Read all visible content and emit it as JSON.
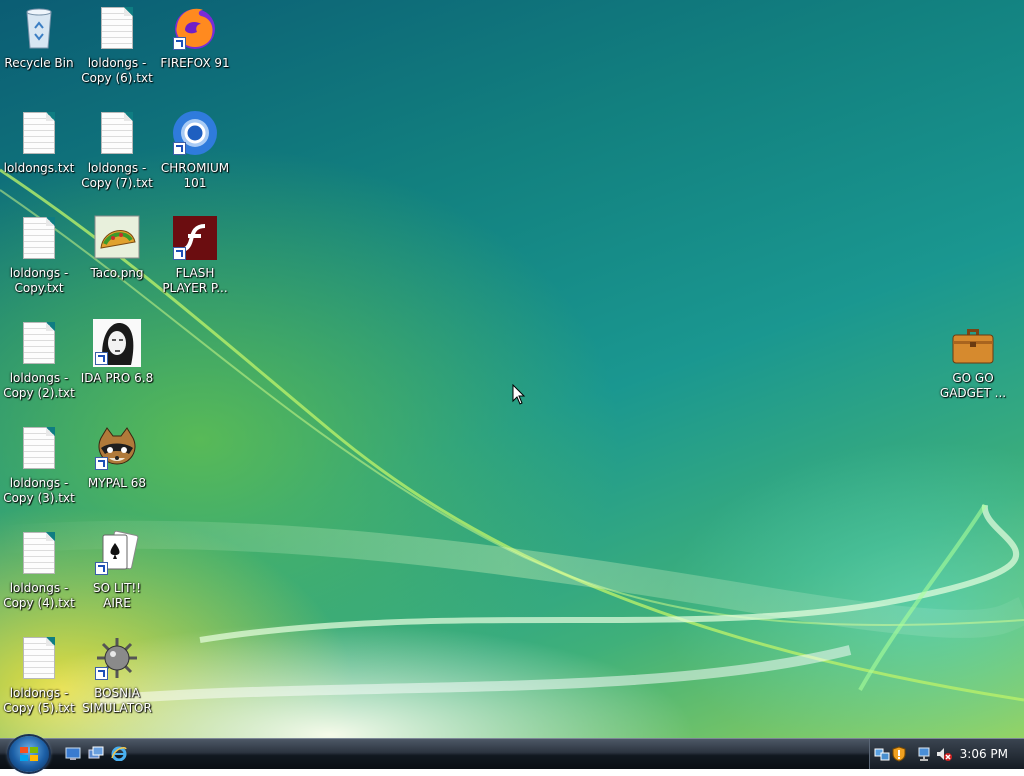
{
  "desktop": {
    "icons": [
      {
        "label": "Recycle Bin",
        "icon": "recycle-bin-icon"
      },
      {
        "label": "loldongs - Copy (6).txt",
        "icon": "text-file-icon"
      },
      {
        "label": "FIREFOX 91",
        "icon": "firefox-icon"
      },
      {
        "label": "loldongs.txt",
        "icon": "text-file-icon"
      },
      {
        "label": "loldongs - Copy (7).txt",
        "icon": "text-file-icon"
      },
      {
        "label": "CHROMIUM 101",
        "icon": "chromium-icon"
      },
      {
        "label": "loldongs - Copy.txt",
        "icon": "text-file-icon"
      },
      {
        "label": "Taco.png",
        "icon": "taco-image-icon"
      },
      {
        "label": "FLASH PLAYER P...",
        "icon": "flash-player-icon"
      },
      {
        "label": "loldongs - Copy (2).txt",
        "icon": "text-file-icon"
      },
      {
        "label": "IDA PRO 6.8",
        "icon": "ida-pro-icon"
      },
      {
        "label": "loldongs - Copy (3).txt",
        "icon": "text-file-icon"
      },
      {
        "label": "MYPAL 68",
        "icon": "mypal-raccoon-icon"
      },
      {
        "label": "loldongs - Copy (4).txt",
        "icon": "text-file-icon"
      },
      {
        "label": "SO LIT!! AIRE",
        "icon": "solitaire-cards-icon"
      },
      {
        "label": "loldongs - Copy (5).txt",
        "icon": "text-file-icon"
      },
      {
        "label": "BOSNIA SIMULATOR",
        "icon": "spiked-mine-icon"
      },
      {
        "label": "GO GO GADGET ...",
        "icon": "briefcase-icon"
      }
    ]
  },
  "taskbar": {
    "start_button": "windows-orb-icon",
    "quick_launch": [
      "show-desktop-icon",
      "switch-windows-icon",
      "internet-explorer-icon"
    ],
    "tray_icons": [
      "network-icon",
      "security-shield-icon",
      "network-connection-icon",
      "volume-muted-icon"
    ],
    "clock": "3:06 PM"
  },
  "colors": {
    "accent": "#1a9790",
    "taskbar": "#1a212b"
  }
}
